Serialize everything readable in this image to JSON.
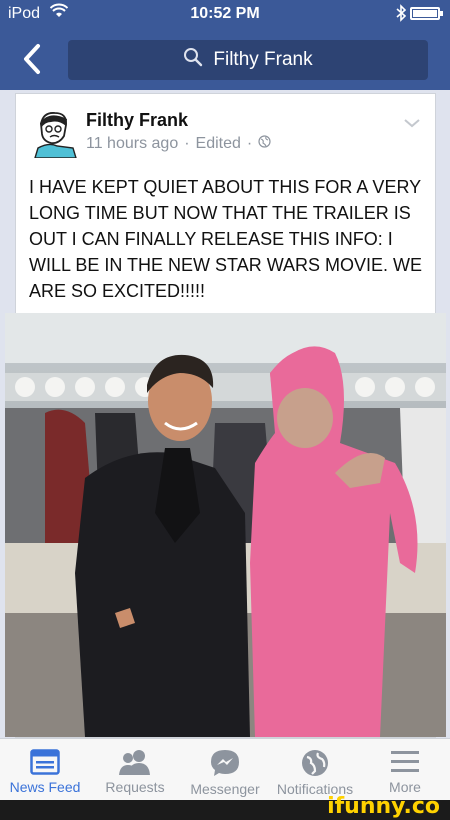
{
  "status": {
    "carrier": "iPod",
    "time": "10:52 PM"
  },
  "nav": {
    "search_text": "Filthy Frank"
  },
  "post": {
    "author": "Filthy Frank",
    "age": "11 hours ago",
    "separator1": "·",
    "edited": "Edited",
    "separator2": "·",
    "text": "I HAVE KEPT QUIET ABOUT THIS FOR A VERY LONG TIME BUT NOW THAT THE TRAILER IS OUT I CAN FINALLY RELEASE THIS INFO: I WILL BE IN THE NEW STAR WARS MOVIE. WE ARE SO EXCITED!!!!!"
  },
  "tabs": [
    {
      "label": "News Feed",
      "icon": "news-feed-icon"
    },
    {
      "label": "Requests",
      "icon": "friends-icon"
    },
    {
      "label": "Messenger",
      "icon": "messenger-icon"
    },
    {
      "label": "Notifications",
      "icon": "globe-icon"
    },
    {
      "label": "More",
      "icon": "menu-icon"
    }
  ],
  "watermark": "ifunny.co",
  "colors": {
    "brand": "#3b5998",
    "active_tab": "#3b73d9",
    "inactive": "#8d949e"
  }
}
